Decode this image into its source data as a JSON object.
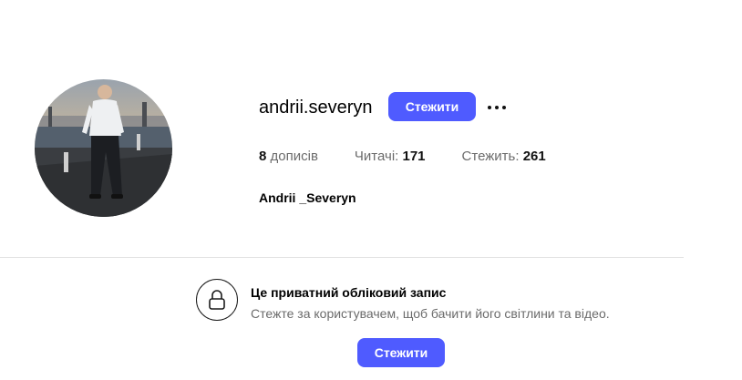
{
  "profile": {
    "username": "andrii.severyn",
    "follow_label": "Стежити",
    "more_icon": "more-dots-icon",
    "avatar_icon": "profile-photo",
    "full_name": "Andrii _Severyn",
    "stats": {
      "posts_count": "8",
      "posts_label": "дописів",
      "followers_label": "Читачі:",
      "followers_count": "171",
      "following_label": "Стежить:",
      "following_count": "261"
    }
  },
  "private_notice": {
    "icon": "lock-icon",
    "title": "Це приватний обліковий запис",
    "description": "Стежте за користувачем, щоб бачити його світлини та відео.",
    "follow_label": "Стежити"
  },
  "colors": {
    "accent": "#4f5bff",
    "text_primary": "#000000",
    "text_secondary": "#6b6b6b",
    "divider": "#e2e2e2"
  }
}
